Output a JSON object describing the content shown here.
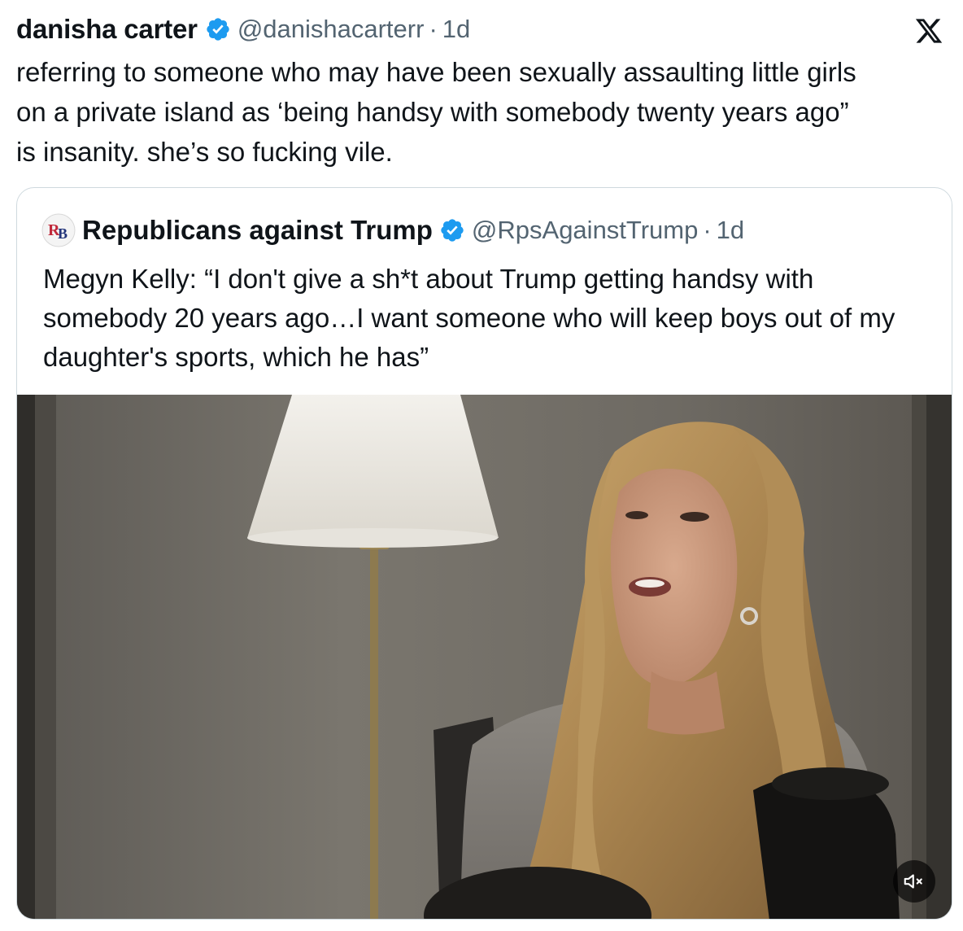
{
  "post": {
    "author_name": "danisha carter",
    "handle": "@danishacarterr",
    "separator": "·",
    "time": "1d",
    "text": "referring to someone who may have been sexually assaulting little girls\non a private island as ‘being handsy with somebody twenty years ago”\nis insanity. she’s so fucking vile."
  },
  "quoted_post": {
    "avatar_text": "RB",
    "author_name": "Republicans against Trump",
    "handle": "@RpsAgainstTrump",
    "separator": "·",
    "time": "1d",
    "text": "Megyn Kelly: “I don't give a sh*t about Trump getting handsy with somebody 20 years ago…I want someone who will keep boys out of my daughter's sports, which he has”"
  },
  "icons": {
    "verified": "verified-badge-icon",
    "platform": "x-logo-icon",
    "mute": "speaker-muted-icon"
  },
  "colors": {
    "verified_blue": "#1d9bf0",
    "secondary_text": "#536471",
    "border": "#cfd9de"
  }
}
